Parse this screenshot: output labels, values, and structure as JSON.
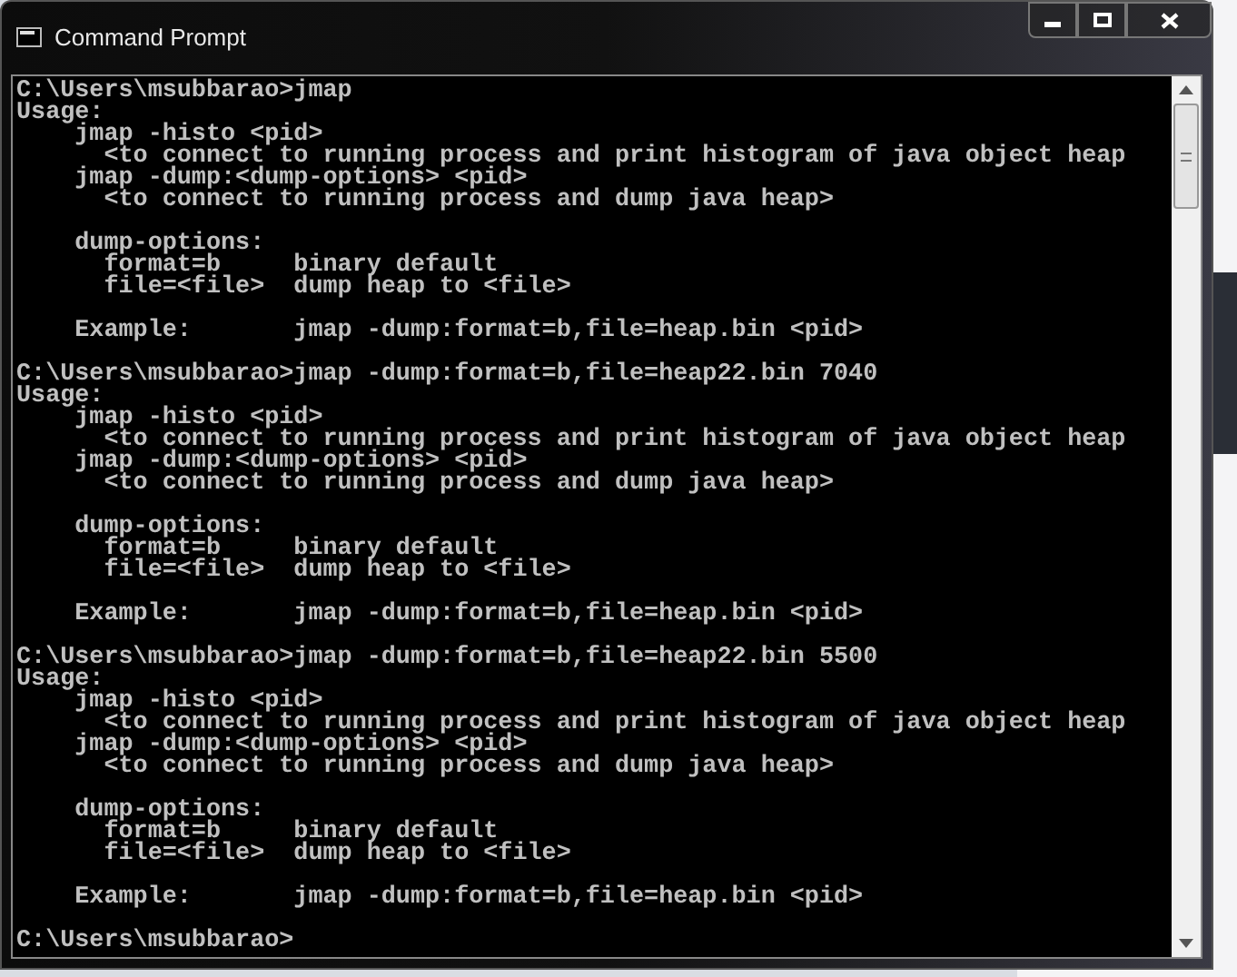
{
  "window": {
    "title": "Command Prompt"
  },
  "console": {
    "blocks": [
      {
        "prompt": "C:\\Users\\msubbarao>jmap",
        "groups": [
          [
            "Usage:",
            "    jmap -histo <pid>",
            "      <to connect to running process and print histogram of java object heap",
            "    jmap -dump:<dump-options> <pid>",
            "      <to connect to running process and dump java heap>"
          ],
          [
            "    dump-options:",
            "      format=b     binary default",
            "      file=<file>  dump heap to <file>"
          ],
          [
            "    Example:       jmap -dump:format=b,file=heap.bin <pid>"
          ]
        ]
      },
      {
        "prompt": "C:\\Users\\msubbarao>jmap -dump:format=b,file=heap22.bin 7040",
        "groups": [
          [
            "Usage:",
            "    jmap -histo <pid>",
            "      <to connect to running process and print histogram of java object heap",
            "    jmap -dump:<dump-options> <pid>",
            "      <to connect to running process and dump java heap>"
          ],
          [
            "    dump-options:",
            "      format=b     binary default",
            "      file=<file>  dump heap to <file>"
          ],
          [
            "    Example:       jmap -dump:format=b,file=heap.bin <pid>"
          ]
        ]
      },
      {
        "prompt": "C:\\Users\\msubbarao>jmap -dump:format=b,file=heap22.bin 5500",
        "groups": [
          [
            "Usage:",
            "    jmap -histo <pid>",
            "      <to connect to running process and print histogram of java object heap",
            "    jmap -dump:<dump-options> <pid>",
            "      <to connect to running process and dump java heap>"
          ],
          [
            "    dump-options:",
            "      format=b     binary default",
            "      file=<file>  dump heap to <file>"
          ],
          [
            "    Example:       jmap -dump:format=b,file=heap.bin <pid>"
          ]
        ]
      },
      {
        "prompt": "C:\\Users\\msubbarao>"
      }
    ]
  }
}
